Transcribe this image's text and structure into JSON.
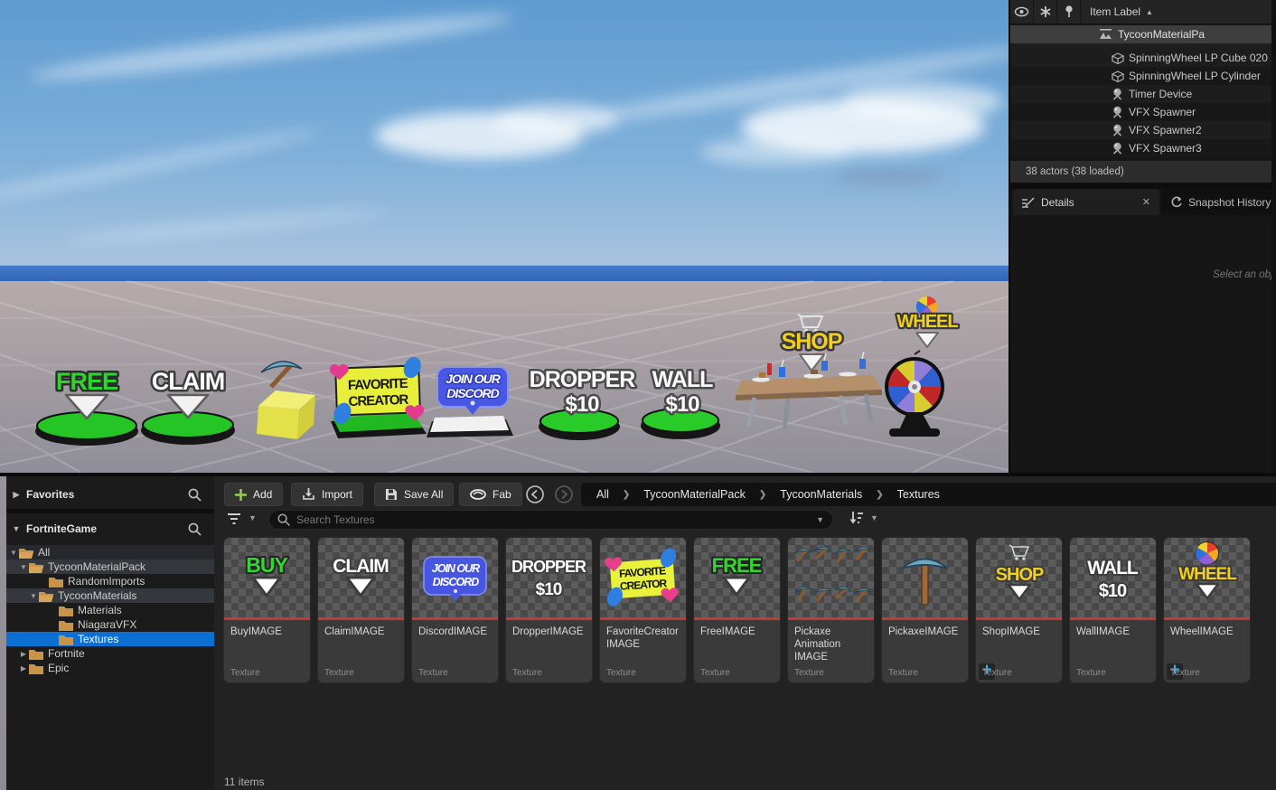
{
  "viewport": {
    "signs": {
      "free": "FREE",
      "claim": "CLAIM",
      "favorite1": "FAVORITE",
      "favorite2": "CREATOR",
      "discord1": "JOIN OUR",
      "discord2": "DISCORD",
      "dropper1": "DROPPER",
      "dropper2": "$10",
      "wall1": "WALL",
      "wall2": "$10",
      "shop": "SHOP",
      "wheel": "WHEEL"
    }
  },
  "outliner": {
    "header": {
      "column": "Item Label",
      "sort": "▲"
    },
    "selected_row": "TycoonMaterialPa",
    "rows": [
      {
        "label": "SpinningWheel LP Cube 020"
      },
      {
        "label": "SpinningWheel LP Cylinder"
      },
      {
        "label": "Timer Device"
      },
      {
        "label": "VFX Spawner"
      },
      {
        "label": "VFX Spawner2"
      },
      {
        "label": "VFX Spawner3"
      }
    ],
    "footer": "38 actors (38 loaded)"
  },
  "details": {
    "tab_details": "Details",
    "tab_snapshot": "Snapshot History",
    "close": "✕",
    "empty": "Select an obje"
  },
  "content_browser": {
    "favorites": "Favorites",
    "source": "FortniteGame",
    "tree": [
      {
        "label": "All"
      },
      {
        "label": "TycoonMaterialPack"
      },
      {
        "label": "RandomImports"
      },
      {
        "label": "TycoonMaterials"
      },
      {
        "label": "Materials"
      },
      {
        "label": "NiagaraVFX"
      },
      {
        "label": "Textures"
      },
      {
        "label": "Fortnite"
      },
      {
        "label": "Epic"
      }
    ],
    "toolbar": {
      "add": "Add",
      "import": "Import",
      "save_all": "Save All",
      "fab": "Fab"
    },
    "breadcrumbs": [
      "All",
      "TycoonMaterialPack",
      "TycoonMaterials",
      "Textures"
    ],
    "search_placeholder": "Search Textures",
    "plus_badge": "+",
    "status": "11 items",
    "assets": [
      {
        "name": "BuyIMAGE",
        "type": "Texture",
        "thumb": [
          "BUY"
        ]
      },
      {
        "name": "ClaimIMAGE",
        "type": "Texture",
        "thumb": [
          "CLAIM"
        ]
      },
      {
        "name": "DiscordIMAGE",
        "type": "Texture",
        "thumb": [
          "JOIN OUR",
          "DISCORD"
        ]
      },
      {
        "name": "DropperIMAGE",
        "type": "Texture",
        "thumb": [
          "DROPPER",
          "$10"
        ]
      },
      {
        "name": "FavoriteCreator\nIMAGE",
        "type": "Texture",
        "thumb": [
          "FAVORITE",
          "CREATOR"
        ]
      },
      {
        "name": "FreeIMAGE",
        "type": "Texture",
        "thumb": [
          "FREE"
        ]
      },
      {
        "name": "Pickaxe\nAnimation\nIMAGE",
        "type": "Texture",
        "thumb": []
      },
      {
        "name": "PickaxeIMAGE",
        "type": "Texture",
        "thumb": []
      },
      {
        "name": "ShopIMAGE",
        "type": "Texture",
        "thumb": [
          "SHOP"
        ]
      },
      {
        "name": "WallIMAGE",
        "type": "Texture",
        "thumb": [
          "WALL",
          "$10"
        ]
      },
      {
        "name": "WheelIMAGE",
        "type": "Texture",
        "thumb": [
          "WHEEL"
        ]
      }
    ]
  },
  "colors": {
    "selection_blue": "#0b6fd4",
    "folder_tan": "#c9944a",
    "texture_red": "#c43a32",
    "add_green": "#95c94e",
    "water_blue": "#3d74c6"
  }
}
